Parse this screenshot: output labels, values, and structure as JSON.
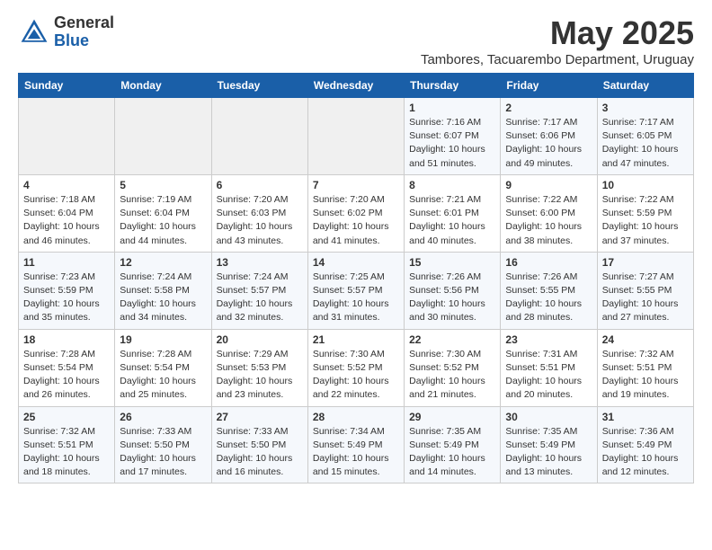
{
  "header": {
    "logo_general": "General",
    "logo_blue": "Blue",
    "month_title": "May 2025",
    "location": "Tambores, Tacuarembo Department, Uruguay"
  },
  "days_of_week": [
    "Sunday",
    "Monday",
    "Tuesday",
    "Wednesday",
    "Thursday",
    "Friday",
    "Saturday"
  ],
  "weeks": [
    [
      {
        "day": "",
        "info": ""
      },
      {
        "day": "",
        "info": ""
      },
      {
        "day": "",
        "info": ""
      },
      {
        "day": "",
        "info": ""
      },
      {
        "day": "1",
        "info": "Sunrise: 7:16 AM\nSunset: 6:07 PM\nDaylight: 10 hours\nand 51 minutes."
      },
      {
        "day": "2",
        "info": "Sunrise: 7:17 AM\nSunset: 6:06 PM\nDaylight: 10 hours\nand 49 minutes."
      },
      {
        "day": "3",
        "info": "Sunrise: 7:17 AM\nSunset: 6:05 PM\nDaylight: 10 hours\nand 47 minutes."
      }
    ],
    [
      {
        "day": "4",
        "info": "Sunrise: 7:18 AM\nSunset: 6:04 PM\nDaylight: 10 hours\nand 46 minutes."
      },
      {
        "day": "5",
        "info": "Sunrise: 7:19 AM\nSunset: 6:04 PM\nDaylight: 10 hours\nand 44 minutes."
      },
      {
        "day": "6",
        "info": "Sunrise: 7:20 AM\nSunset: 6:03 PM\nDaylight: 10 hours\nand 43 minutes."
      },
      {
        "day": "7",
        "info": "Sunrise: 7:20 AM\nSunset: 6:02 PM\nDaylight: 10 hours\nand 41 minutes."
      },
      {
        "day": "8",
        "info": "Sunrise: 7:21 AM\nSunset: 6:01 PM\nDaylight: 10 hours\nand 40 minutes."
      },
      {
        "day": "9",
        "info": "Sunrise: 7:22 AM\nSunset: 6:00 PM\nDaylight: 10 hours\nand 38 minutes."
      },
      {
        "day": "10",
        "info": "Sunrise: 7:22 AM\nSunset: 5:59 PM\nDaylight: 10 hours\nand 37 minutes."
      }
    ],
    [
      {
        "day": "11",
        "info": "Sunrise: 7:23 AM\nSunset: 5:59 PM\nDaylight: 10 hours\nand 35 minutes."
      },
      {
        "day": "12",
        "info": "Sunrise: 7:24 AM\nSunset: 5:58 PM\nDaylight: 10 hours\nand 34 minutes."
      },
      {
        "day": "13",
        "info": "Sunrise: 7:24 AM\nSunset: 5:57 PM\nDaylight: 10 hours\nand 32 minutes."
      },
      {
        "day": "14",
        "info": "Sunrise: 7:25 AM\nSunset: 5:57 PM\nDaylight: 10 hours\nand 31 minutes."
      },
      {
        "day": "15",
        "info": "Sunrise: 7:26 AM\nSunset: 5:56 PM\nDaylight: 10 hours\nand 30 minutes."
      },
      {
        "day": "16",
        "info": "Sunrise: 7:26 AM\nSunset: 5:55 PM\nDaylight: 10 hours\nand 28 minutes."
      },
      {
        "day": "17",
        "info": "Sunrise: 7:27 AM\nSunset: 5:55 PM\nDaylight: 10 hours\nand 27 minutes."
      }
    ],
    [
      {
        "day": "18",
        "info": "Sunrise: 7:28 AM\nSunset: 5:54 PM\nDaylight: 10 hours\nand 26 minutes."
      },
      {
        "day": "19",
        "info": "Sunrise: 7:28 AM\nSunset: 5:54 PM\nDaylight: 10 hours\nand 25 minutes."
      },
      {
        "day": "20",
        "info": "Sunrise: 7:29 AM\nSunset: 5:53 PM\nDaylight: 10 hours\nand 23 minutes."
      },
      {
        "day": "21",
        "info": "Sunrise: 7:30 AM\nSunset: 5:52 PM\nDaylight: 10 hours\nand 22 minutes."
      },
      {
        "day": "22",
        "info": "Sunrise: 7:30 AM\nSunset: 5:52 PM\nDaylight: 10 hours\nand 21 minutes."
      },
      {
        "day": "23",
        "info": "Sunrise: 7:31 AM\nSunset: 5:51 PM\nDaylight: 10 hours\nand 20 minutes."
      },
      {
        "day": "24",
        "info": "Sunrise: 7:32 AM\nSunset: 5:51 PM\nDaylight: 10 hours\nand 19 minutes."
      }
    ],
    [
      {
        "day": "25",
        "info": "Sunrise: 7:32 AM\nSunset: 5:51 PM\nDaylight: 10 hours\nand 18 minutes."
      },
      {
        "day": "26",
        "info": "Sunrise: 7:33 AM\nSunset: 5:50 PM\nDaylight: 10 hours\nand 17 minutes."
      },
      {
        "day": "27",
        "info": "Sunrise: 7:33 AM\nSunset: 5:50 PM\nDaylight: 10 hours\nand 16 minutes."
      },
      {
        "day": "28",
        "info": "Sunrise: 7:34 AM\nSunset: 5:49 PM\nDaylight: 10 hours\nand 15 minutes."
      },
      {
        "day": "29",
        "info": "Sunrise: 7:35 AM\nSunset: 5:49 PM\nDaylight: 10 hours\nand 14 minutes."
      },
      {
        "day": "30",
        "info": "Sunrise: 7:35 AM\nSunset: 5:49 PM\nDaylight: 10 hours\nand 13 minutes."
      },
      {
        "day": "31",
        "info": "Sunrise: 7:36 AM\nSunset: 5:49 PM\nDaylight: 10 hours\nand 12 minutes."
      }
    ]
  ]
}
